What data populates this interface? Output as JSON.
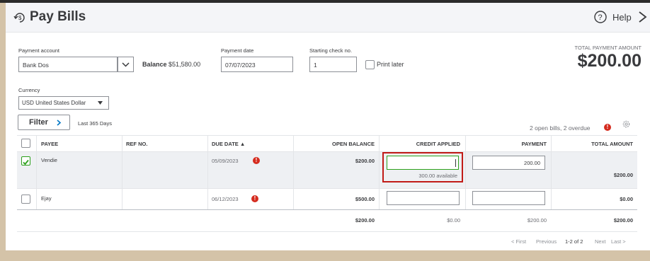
{
  "header": {
    "title": "Pay Bills",
    "help_label": "Help"
  },
  "payment": {
    "account_label": "Payment account",
    "account_value": "Bank Dos",
    "balance_label": "Balance",
    "balance_value": "$51,580.00",
    "date_label": "Payment date",
    "date_value": "07/07/2023",
    "check_label": "Starting check no.",
    "check_value": "1",
    "print_later_label": "Print later",
    "total_label": "TOTAL PAYMENT AMOUNT",
    "total_value": "$200.00"
  },
  "currency": {
    "label": "Currency",
    "value": "USD United States Dollar"
  },
  "filter": {
    "button_label": "Filter",
    "days_label": "Last 365 Days",
    "open_bills": "2 open bills, 2 overdue"
  },
  "table": {
    "headers": {
      "payee": "PAYEE",
      "ref": "REF NO.",
      "due": "DUE DATE ▲",
      "open_balance": "OPEN BALANCE",
      "credit": "CREDIT APPLIED",
      "payment": "PAYMENT",
      "total": "TOTAL AMOUNT"
    },
    "rows": [
      {
        "payee": "Vendie",
        "due": "05/09/2023",
        "open_balance": "$200.00",
        "credit_available": "300.00 available",
        "payment": "200.00",
        "total": "$200.00",
        "checked": true
      },
      {
        "payee": "Ejay",
        "due": "06/12/2023",
        "open_balance": "$500.00",
        "payment": "",
        "total": "$0.00",
        "checked": false
      }
    ],
    "totals": {
      "open_balance": "$200.00",
      "credit": "$0.00",
      "payment": "$200.00",
      "total": "$200.00"
    }
  },
  "pager": {
    "first": "< First",
    "previous": "Previous",
    "range": "1-2 of 2",
    "next": "Next",
    "last": "Last >"
  },
  "icons": {
    "title_icon": "pay-bills-icon",
    "help": "help-circle-icon",
    "close": "close-icon",
    "settings": "gear-icon",
    "overdue": "alert-icon"
  },
  "colors": {
    "accent_green": "#2ca01c",
    "alert_red": "#d52b1e",
    "highlight_red": "#c11b17"
  }
}
